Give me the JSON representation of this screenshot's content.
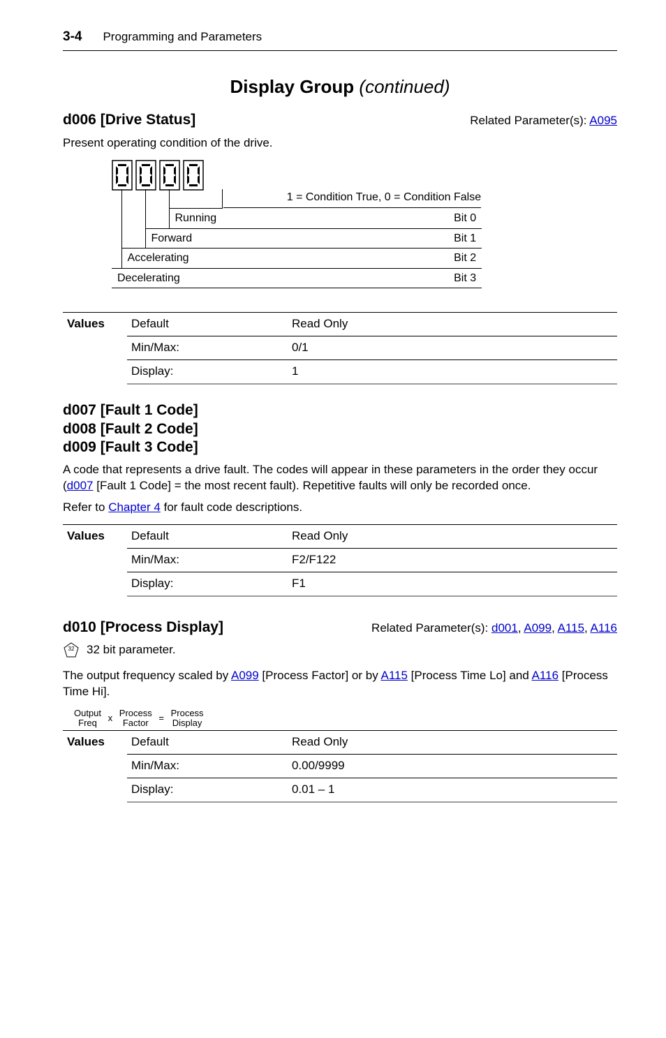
{
  "header": {
    "page_no": "3-4",
    "title": "Programming and Parameters"
  },
  "section": {
    "title": "Display Group",
    "subtitle": "(continued)"
  },
  "d006": {
    "code": "d006",
    "name": "[Drive Status]",
    "related_label": "Related Parameter(s):",
    "related_links": [
      "A095"
    ],
    "desc": "Present operating condition of the drive.",
    "legend": "1 = Condition True, 0 = Condition False",
    "bits": [
      {
        "label": "Running",
        "bit": "Bit 0"
      },
      {
        "label": "Forward",
        "bit": "Bit 1"
      },
      {
        "label": "Accelerating",
        "bit": "Bit 2"
      },
      {
        "label": "Decelerating",
        "bit": "Bit 3"
      }
    ],
    "values": {
      "heading": "Values",
      "rows": [
        {
          "k": "Default",
          "v": "Read Only"
        },
        {
          "k": "Min/Max:",
          "v": "0/1"
        },
        {
          "k": "Display:",
          "v": "1"
        }
      ]
    }
  },
  "faults": {
    "lines": [
      "d007 [Fault 1 Code]",
      "d008 [Fault 2 Code]",
      "d009 [Fault 3 Code]"
    ],
    "desc_pre": "A code that represents a drive fault. The codes will appear in these parameters in the order they occur (",
    "desc_link": "d007",
    "desc_post": " [Fault 1 Code] = the most recent fault). Repetitive faults will only be recorded once.",
    "refer_pre": "Refer to ",
    "refer_link": "Chapter 4",
    "refer_post": " for fault code descriptions.",
    "values": {
      "heading": "Values",
      "rows": [
        {
          "k": "Default",
          "v": "Read Only"
        },
        {
          "k": "Min/Max:",
          "v": "F2/F122"
        },
        {
          "k": "Display:",
          "v": "F1"
        }
      ]
    }
  },
  "d010": {
    "code": "d010",
    "name": "[Process Display]",
    "related_label": "Related Parameter(s):",
    "related_links": [
      "d001",
      "A099",
      "A115",
      "A116"
    ],
    "d32_label": "32 bit parameter.",
    "desc_pre": "The output frequency scaled by ",
    "desc_a099": "A099",
    "desc_mid1": " [Process Factor] or by ",
    "desc_a115": "A115",
    "desc_mid2": " [Process Time Lo] and ",
    "desc_a116": "A116",
    "desc_post": " [Process Time Hi].",
    "eq": {
      "a_top": "Output",
      "a_bot": "Freq",
      "op1": "x",
      "b_top": "Process",
      "b_bot": "Factor",
      "op2": "=",
      "c_top": "Process",
      "c_bot": "Display"
    },
    "values": {
      "heading": "Values",
      "rows": [
        {
          "k": "Default",
          "v": "Read Only"
        },
        {
          "k": "Min/Max:",
          "v": "0.00/9999"
        },
        {
          "k": "Display:",
          "v": "0.01 – 1"
        }
      ]
    }
  }
}
